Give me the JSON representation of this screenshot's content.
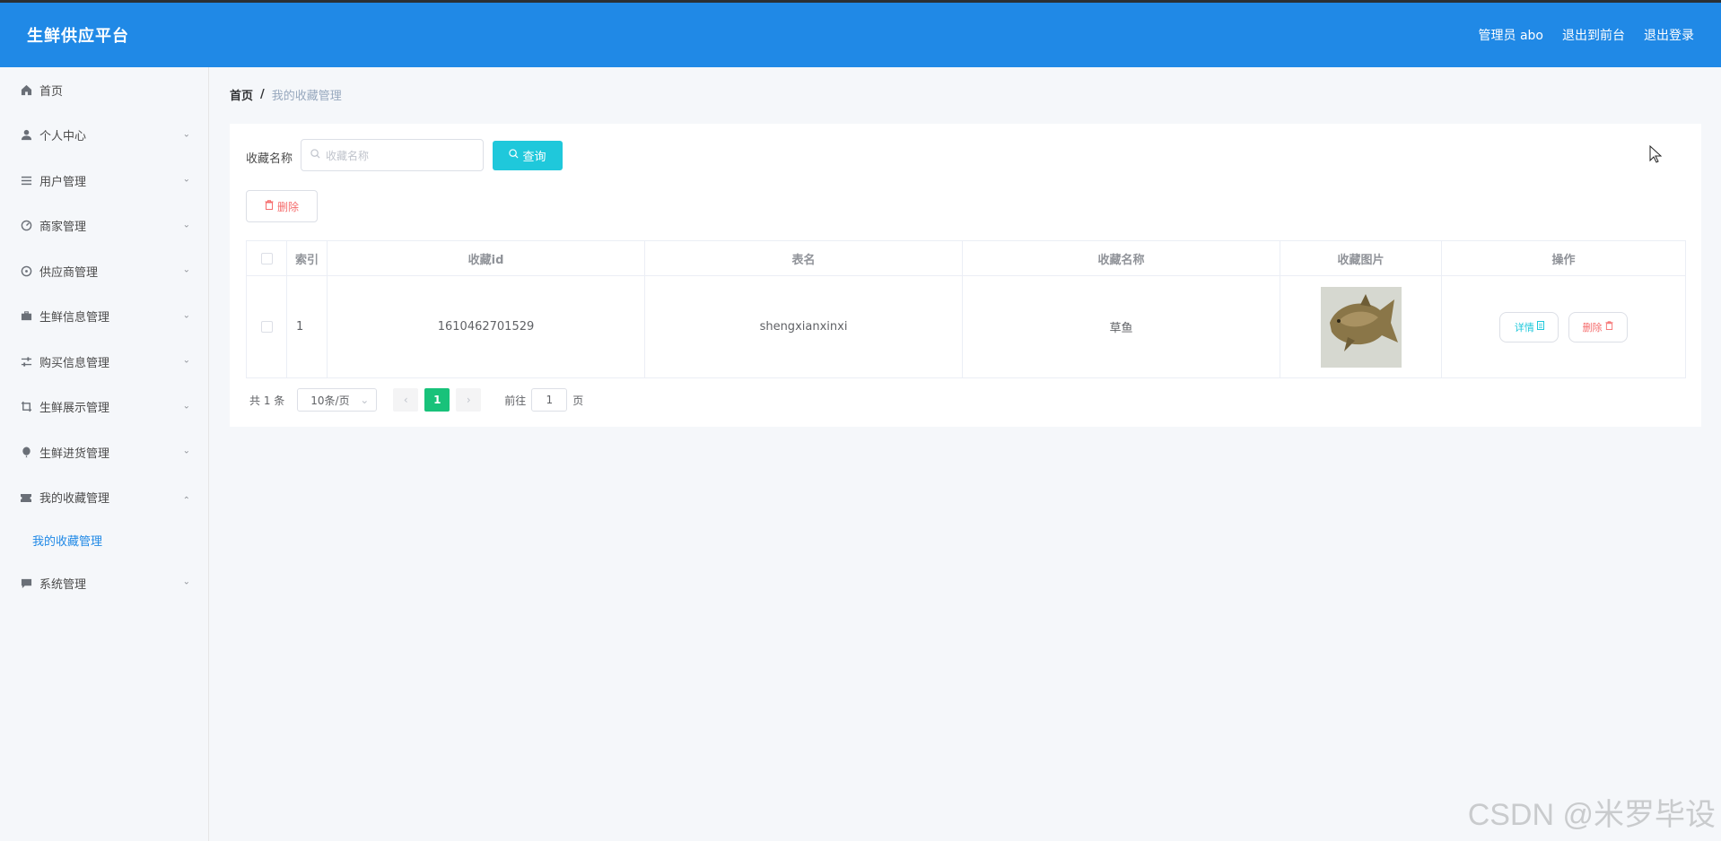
{
  "header": {
    "brand": "生鲜供应平台",
    "admin": "管理员 abo",
    "to_front": "退出到前台",
    "logout": "退出登录"
  },
  "sidebar": {
    "items": [
      {
        "label": "首页",
        "icon": "home-icon"
      },
      {
        "label": "个人中心",
        "icon": "user-icon"
      },
      {
        "label": "用户管理",
        "icon": "list-icon"
      },
      {
        "label": "商家管理",
        "icon": "dashboard-icon"
      },
      {
        "label": "供应商管理",
        "icon": "compass-icon"
      },
      {
        "label": "生鲜信息管理",
        "icon": "briefcase-icon"
      },
      {
        "label": "购买信息管理",
        "icon": "sliders-icon"
      },
      {
        "label": "生鲜展示管理",
        "icon": "crop-icon"
      },
      {
        "label": "生鲜进货管理",
        "icon": "balloon-icon"
      },
      {
        "label": "我的收藏管理",
        "icon": "ticket-icon"
      },
      {
        "label": "系统管理",
        "icon": "chat-icon"
      }
    ],
    "sub_item": "我的收藏管理"
  },
  "breadcrumb": {
    "home": "首页",
    "sep": "/",
    "current": "我的收藏管理"
  },
  "search": {
    "label": "收藏名称",
    "placeholder": "收藏名称",
    "button": "查询"
  },
  "toolbar": {
    "delete": "删除"
  },
  "table": {
    "headers": [
      "",
      "索引",
      "收藏id",
      "表名",
      "收藏名称",
      "收藏图片",
      "操作"
    ],
    "rows": [
      {
        "index": "1",
        "id": "1610462701529",
        "table": "shengxianxinxi",
        "name": "草鱼"
      }
    ],
    "detail_label": "详情",
    "delete_label": "删除"
  },
  "pager": {
    "total": "共 1 条",
    "size": "10条/页",
    "page": "1",
    "goto": "前往",
    "goto_value": "1",
    "page_unit": "页"
  },
  "watermark": "CSDN @米罗毕设",
  "colors": {
    "header": "#2089e6",
    "accent": "#1fc8db",
    "danger": "#f56c6c",
    "page_active": "#18c27a"
  }
}
